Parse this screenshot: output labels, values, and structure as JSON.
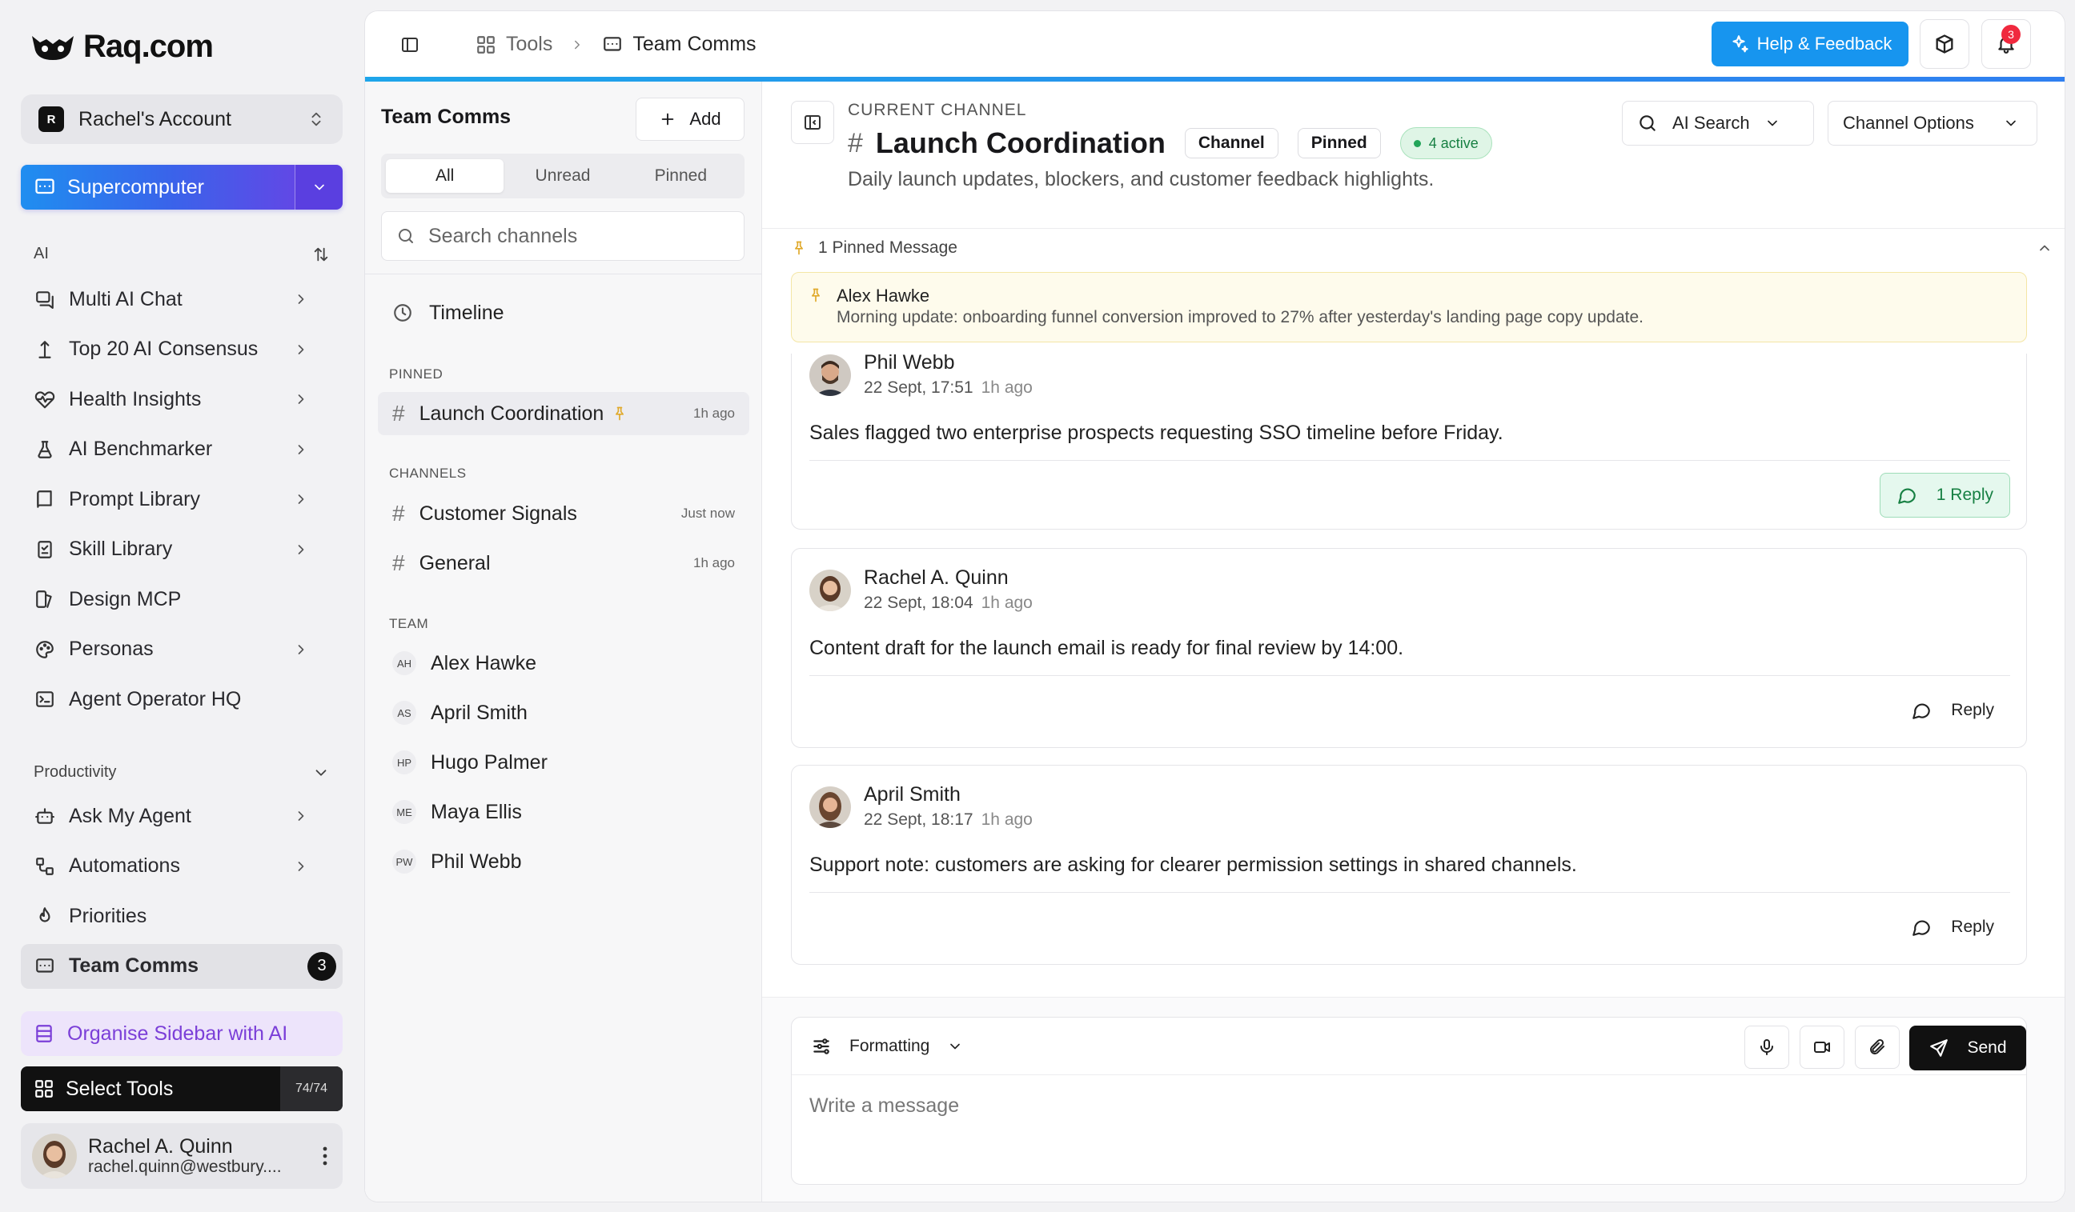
{
  "brand": {
    "name": "Raq.com"
  },
  "account": {
    "initial": "R",
    "name": "Rachel's Account"
  },
  "supercomputer": {
    "label": "Supercomputer"
  },
  "sidebar": {
    "ai_header": "AI",
    "ai_items": [
      {
        "label": "Multi AI Chat",
        "icon": "chat-icon",
        "has_arrow": true
      },
      {
        "label": "Top 20 AI Consensus",
        "icon": "consensus-icon",
        "has_arrow": true
      },
      {
        "label": "Health Insights",
        "icon": "heart-pulse-icon",
        "has_arrow": true
      },
      {
        "label": "AI Benchmarker",
        "icon": "flask-icon",
        "has_arrow": true
      },
      {
        "label": "Prompt Library",
        "icon": "book-icon",
        "has_arrow": true
      },
      {
        "label": "Skill Library",
        "icon": "checklist-icon",
        "has_arrow": true
      },
      {
        "label": "Design MCP",
        "icon": "design-icon",
        "has_arrow": false
      },
      {
        "label": "Personas",
        "icon": "palette-icon",
        "has_arrow": true
      },
      {
        "label": "Agent Operator HQ",
        "icon": "terminal-icon",
        "has_arrow": false
      }
    ],
    "productivity_header": "Productivity",
    "productivity_items": [
      {
        "label": "Ask My Agent",
        "icon": "bot-icon",
        "has_arrow": true
      },
      {
        "label": "Automations",
        "icon": "workflow-icon",
        "has_arrow": true
      },
      {
        "label": "Priorities",
        "icon": "flame-icon",
        "has_arrow": false
      },
      {
        "label": "Team Comms",
        "icon": "message-square-icon",
        "active": true,
        "count": "3"
      }
    ],
    "organise_label": "Organise Sidebar with AI",
    "select_tools_label": "Select Tools",
    "select_tools_count": "74/74"
  },
  "user": {
    "name": "Rachel A. Quinn",
    "email": "rachel.quinn@westbury...."
  },
  "topbar": {
    "breadcrumb_tools": "Tools",
    "breadcrumb_current": "Team Comms",
    "help_label": "Help & Feedback",
    "notification_count": "3"
  },
  "channel_list": {
    "title": "Team Comms",
    "add_label": "Add",
    "tabs": [
      "All",
      "Unread",
      "Pinned"
    ],
    "search_placeholder": "Search channels",
    "timeline_label": "Timeline",
    "pinned_label": "PINNED",
    "pinned": [
      {
        "name": "Launch Coordination",
        "time": "1h ago"
      }
    ],
    "channels_label": "CHANNELS",
    "channels": [
      {
        "name": "Customer Signals",
        "time": "Just now"
      },
      {
        "name": "General",
        "time": "1h ago"
      }
    ],
    "team_label": "TEAM",
    "team": [
      {
        "initials": "AH",
        "name": "Alex Hawke"
      },
      {
        "initials": "AS",
        "name": "April Smith"
      },
      {
        "initials": "HP",
        "name": "Hugo Palmer"
      },
      {
        "initials": "ME",
        "name": "Maya Ellis"
      },
      {
        "initials": "PW",
        "name": "Phil Webb"
      }
    ]
  },
  "channel": {
    "current_label": "CURRENT CHANNEL",
    "name": "Launch Coordination",
    "tag_channel": "Channel",
    "tag_pinned": "Pinned",
    "active_label": "4 active",
    "description": "Daily launch updates, blockers, and customer feedback highlights.",
    "ai_search_label": "AI Search",
    "options_label": "Channel Options"
  },
  "pinned_message": {
    "header": "1 Pinned Message",
    "author": "Alex Hawke",
    "text": "Morning update: onboarding funnel conversion improved to 27% after yesterday's landing page copy update."
  },
  "messages": [
    {
      "author": "Phil Webb",
      "time": "22 Sept, 17:51",
      "ago": "1h ago",
      "text": "Sales flagged two enterprise prospects requesting SSO timeline before Friday.",
      "reply_label": "1 Reply"
    },
    {
      "author": "Rachel A. Quinn",
      "time": "22 Sept, 18:04",
      "ago": "1h ago",
      "text": "Content draft for the launch email is ready for final review by 14:00.",
      "reply_label": "Reply"
    },
    {
      "author": "April Smith",
      "time": "22 Sept, 18:17",
      "ago": "1h ago",
      "text": "Support note: customers are asking for clearer permission settings in shared channels.",
      "reply_label": "Reply"
    }
  ],
  "composer": {
    "formatting_label": "Formatting",
    "placeholder": "Write a message",
    "send_label": "Send"
  },
  "colors": {
    "accent_blue": "#1795ef",
    "active_green": "#22a559",
    "pin_yellow": "#e0a92a",
    "organise_purple": "#7b3fd8"
  }
}
